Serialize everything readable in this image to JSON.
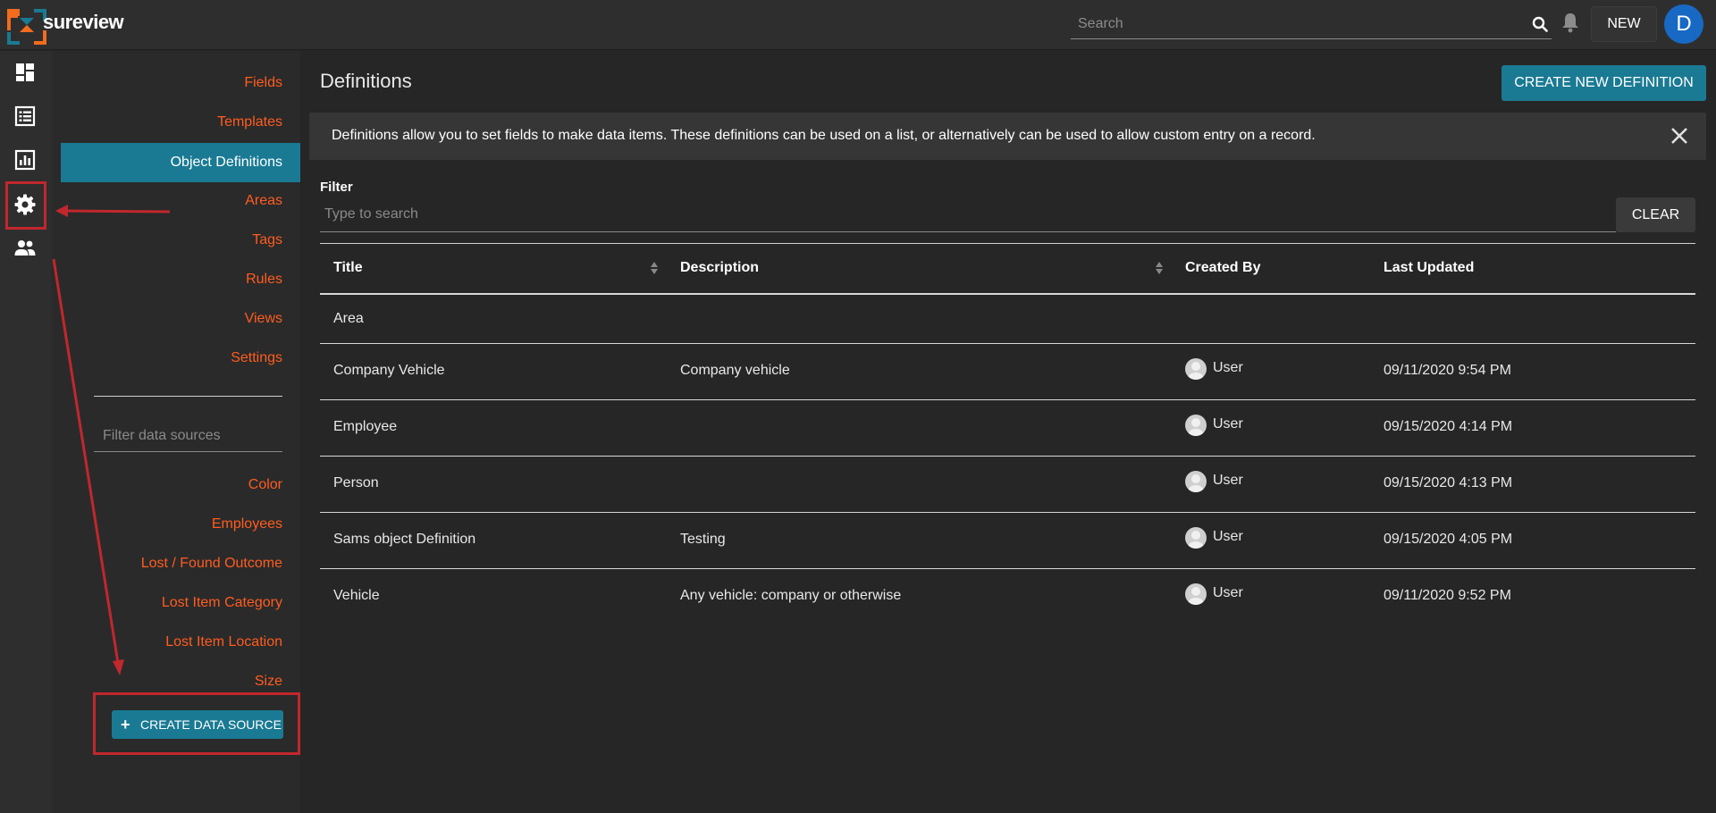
{
  "app": {
    "brand": "sureview"
  },
  "header": {
    "search_placeholder": "Search",
    "new_label": "NEW",
    "avatar_initial": "D"
  },
  "rail": {
    "items": [
      "dashboard-icon",
      "list-icon",
      "reports-icon",
      "settings-icon",
      "people-icon"
    ]
  },
  "subnav": {
    "links": [
      "Fields",
      "Templates",
      "Object Definitions",
      "Areas",
      "Tags",
      "Rules",
      "Views",
      "Settings"
    ],
    "active_index": 2,
    "filter_placeholder": "Filter data sources",
    "data_sources": [
      "Color",
      "Employees",
      "Lost / Found Outcome",
      "Lost Item Category",
      "Lost Item Location",
      "Size"
    ],
    "create_label": "CREATE DATA SOURCE"
  },
  "main": {
    "title": "Definitions",
    "create_label": "CREATE NEW DEFINITION",
    "info": "Definitions allow you to set fields to make data items. These definitions can be used on a list, or alternatively can be used to allow custom entry on a record.",
    "filter_label": "Filter",
    "filter_placeholder": "Type to search",
    "clear_label": "CLEAR"
  },
  "table": {
    "headers": [
      "Title",
      "Description",
      "Created By",
      "Last Updated"
    ],
    "rows": [
      {
        "title": "Area",
        "description": "",
        "created_by": "",
        "updated": ""
      },
      {
        "title": "Company Vehicle",
        "description": "Company vehicle",
        "created_by": "User",
        "updated": "09/11/2020 9:54 PM"
      },
      {
        "title": "Employee",
        "description": "",
        "created_by": "User",
        "updated": "09/15/2020 4:14 PM"
      },
      {
        "title": "Person",
        "description": "",
        "created_by": "User",
        "updated": "09/15/2020 4:13 PM"
      },
      {
        "title": "Sams object Definition",
        "description": "Testing",
        "created_by": "User",
        "updated": "09/15/2020 4:05 PM"
      },
      {
        "title": "Vehicle",
        "description": "Any vehicle: company or otherwise",
        "created_by": "User",
        "updated": "09/11/2020 9:52 PM"
      }
    ]
  },
  "colors": {
    "accent": "#1a7a93",
    "link": "#ff5c1f",
    "annotation": "#c1272d",
    "avatar": "#1769c4"
  }
}
